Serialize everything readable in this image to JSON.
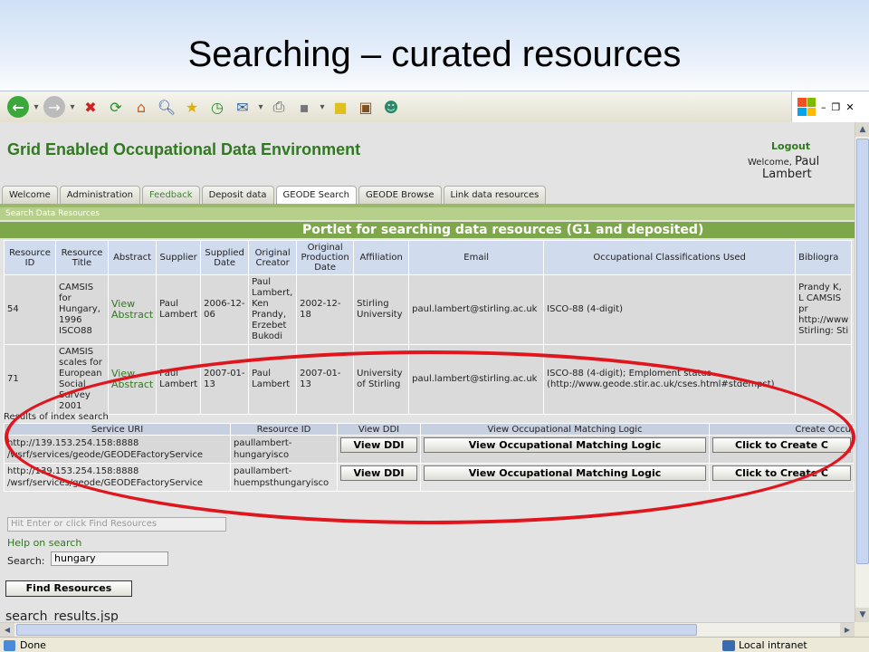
{
  "slide": {
    "title": "Searching – curated resources"
  },
  "browser": {
    "status_text": "Done",
    "zone_text": "Local intranet"
  },
  "app": {
    "title": "Grid Enabled Occupational Data Environment",
    "logout": "Logout",
    "welcome_prefix": "Welcome,",
    "welcome_first": "Paul",
    "welcome_last": "Lambert",
    "tabs": [
      {
        "label": "Welcome"
      },
      {
        "label": "Administration"
      },
      {
        "label": "Feedback"
      },
      {
        "label": "Deposit data"
      },
      {
        "label": "GEODE Search"
      },
      {
        "label": "GEODE Browse"
      },
      {
        "label": "Link data resources"
      }
    ],
    "section": "Search Data Resources",
    "portlet_title": "Portlet for searching data resources (G1 and deposited)"
  },
  "results": {
    "headers": [
      "Resource ID",
      "Resource Title",
      "Abstract",
      "Supplier",
      "Supplied Date",
      "Original Creator",
      "Original Production Date",
      "Affiliation",
      "Email",
      "Occupational Classifications Used",
      "Bibliogra"
    ],
    "rows": [
      {
        "id": "54",
        "title": "CAMSIS for Hungary, 1996 ISCO88",
        "abstract": "View Abstract",
        "supplier": "Paul Lambert",
        "supplied": "2006-12-06",
        "creator": "Paul Lambert, Ken Prandy, Erzebet Bukodi",
        "production": "2002-12-18",
        "affiliation": "Stirling University",
        "email": "paul.lambert@stirling.ac.uk",
        "classifications": "ISCO-88 (4-digit)",
        "biblio": "Prandy K, L CAMSIS pr http://www Stirling: Sti"
      },
      {
        "id": "71",
        "title": "CAMSIS scales for European Social Survey 2001",
        "abstract": "View Abstract",
        "supplier": "Paul Lambert",
        "supplied": "2007-01-13",
        "creator": "Paul Lambert",
        "production": "2007-01-13",
        "affiliation": "University of Stirling",
        "email": "paul.lambert@stirling.ac.uk",
        "classifications": "ISCO-88 (4-digit); Emploment status (http://www.geode.stir.ac.uk/cses.html#stdempst)",
        "biblio": ""
      }
    ]
  },
  "index_search": {
    "label": "Results of index search",
    "headers": [
      "Service URI",
      "Resource ID",
      "View DDI",
      "View Occupational Matching Logic",
      "Create Occu"
    ],
    "rows": [
      {
        "uri_line1": "http://139.153.254.158:8888",
        "uri_line2": "/wsrf/services/geode/GEODEFactoryService",
        "resource_id": "paullambert-hungaryisco",
        "ddi_button": "View DDI",
        "logic_button": "View Occupational Matching Logic",
        "create_button": "Click to Create C"
      },
      {
        "uri_line1": "http://139.153.254.158:8888",
        "uri_line2": "/wsrf/services/geode/GEODEFactoryService",
        "resource_id": "paullambert-huempsthungaryisco",
        "ddi_button": "View DDI",
        "logic_button": "View Occupational Matching Logic",
        "create_button": "Click to Create C"
      }
    ]
  },
  "search": {
    "hint": "Hit Enter or click Find Resources",
    "help": "Help on search",
    "label": "Search:",
    "value": "hungary",
    "button": "Find Resources",
    "page_name": "search_results.jsp"
  },
  "colors": {
    "accent_green": "#2f7a1e",
    "portlet_green": "#7da74a",
    "highlight_red": "#e0161e"
  }
}
